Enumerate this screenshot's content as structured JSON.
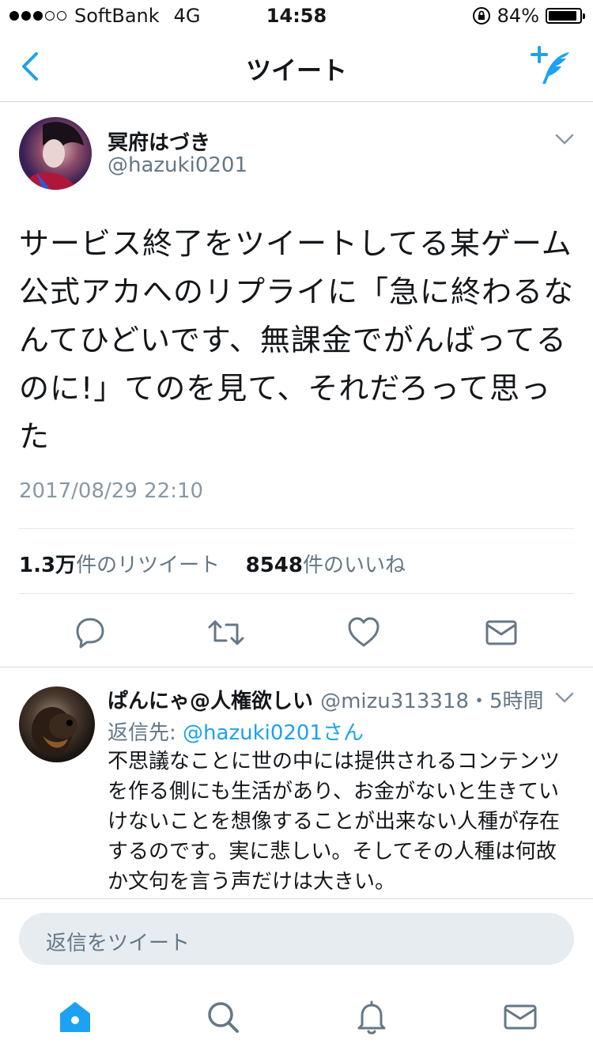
{
  "status_bar": {
    "carrier": "SoftBank",
    "network": "4G",
    "time": "14:58",
    "battery": "84%",
    "battery_level": 0.84,
    "signal_bars_filled": 3,
    "signal_bars_total": 5,
    "lock_icon": "orientation-lock-icon"
  },
  "nav": {
    "title": "ツイート",
    "back_icon": "chevron-left-icon",
    "compose_icon": "compose-tweet-icon"
  },
  "tweet": {
    "display_name": "冥府はづき",
    "handle": "@hazuki0201",
    "text": "サービス終了をツイートしてる某ゲーム公式アカへのリプライに「急に終わるなんてひどいです、無課金でがんばってるのに!」てのを見て、それだろって思った",
    "timestamp": "2017/08/29 22:10",
    "retweets_count": "1.3万",
    "retweets_label": "件のリツイート",
    "likes_count": "8548",
    "likes_label": "件のいいね"
  },
  "reply": {
    "display_name": "ぱんにゃ@人権欲しい",
    "handle": "@mizu313318",
    "time_ago": "・5時間",
    "reply_to_label": "返信先: ",
    "reply_to_handle": "@hazuki0201さん",
    "text": "不思議なことに世の中には提供されるコンテンツを作る側にも生活があり、お金がないと生きていけないことを想像することが出来ない人種が存在するのです。実に悲しい。そしてその人種は何故か文句を言う声だけは大きい。"
  },
  "compose_placeholder": "返信をツイート",
  "colors": {
    "accent": "#1da1f2",
    "muted": "#657786",
    "icon_gray": "#657786",
    "divider": "#e1e8ed",
    "input_bg": "#e6ecf0"
  },
  "tabs": [
    "home-icon",
    "search-icon",
    "notifications-icon",
    "messages-icon"
  ]
}
